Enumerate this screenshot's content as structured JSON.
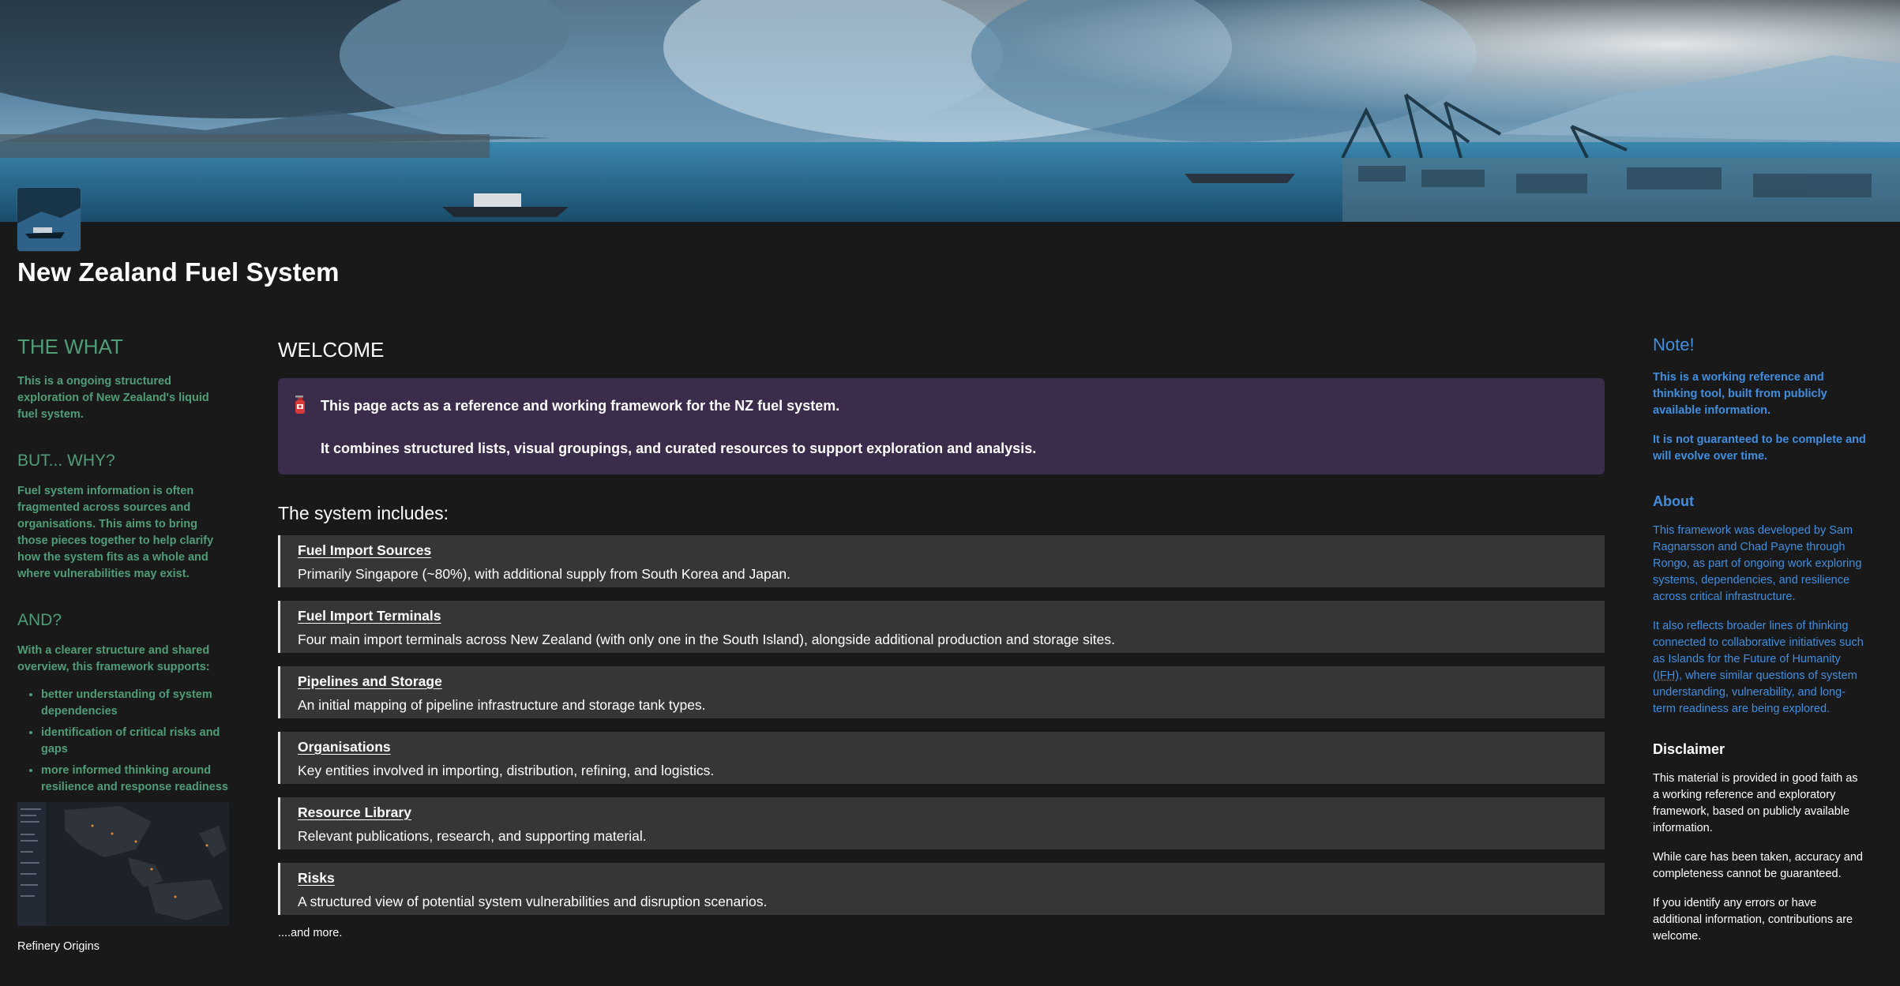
{
  "page": {
    "title": "New Zealand Fuel System"
  },
  "left": {
    "what_heading": "THE WHAT",
    "what_text": "This is a ongoing structured exploration of New Zealand's liquid fuel system.",
    "why_heading": "BUT... WHY?",
    "why_text": "Fuel system information is often fragmented across sources and organisations. This aims to bring those pieces together to help clarify how the system fits as a whole and where vulnerabilities may exist.",
    "and_heading": "AND?",
    "and_text": "With a clearer structure and shared overview, this framework supports:",
    "bullets": [
      "better understanding of system dependencies",
      "identification of critical risks and gaps",
      "more informed thinking around resilience and response readiness"
    ],
    "map_caption": "Refinery Origins"
  },
  "main": {
    "welcome": "WELCOME",
    "callout_line1": "This page acts as a reference and working framework for the NZ fuel system.",
    "callout_line2": "It combines structured lists, visual groupings, and curated resources to support exploration and analysis.",
    "includes_heading": "The system includes:",
    "items": [
      {
        "title": "Fuel Import Sources",
        "desc": "Primarily Singapore (~80%), with additional supply from South Korea and Japan."
      },
      {
        "title": "Fuel Import Terminals",
        "desc": "Four main import terminals across New Zealand (with only one in the South Island), alongside additional production and storage sites."
      },
      {
        "title": "Pipelines and Storage",
        "desc": "An initial mapping of pipeline infrastructure and storage tank types."
      },
      {
        "title": "Organisations",
        "desc": "Key entities involved in importing, distribution, refining, and logistics."
      },
      {
        "title": "Resource Library",
        "desc": "Relevant publications, research, and supporting material."
      },
      {
        "title": "Risks",
        "desc": "A structured view of potential system vulnerabilities and disruption scenarios."
      }
    ],
    "and_more": "....and more."
  },
  "right": {
    "note_heading": "Note!",
    "note_p1": "This is a working reference and thinking tool, built from publicly available information.",
    "note_p2": "It is not guaranteed to be complete and will evolve over time.",
    "about_heading": "About",
    "about_p1": "This framework was developed by Sam Ragnarsson and Chad Payne through Rongo, as part of ongoing work exploring systems, dependencies, and resilience across critical infrastructure.",
    "about_p2_before": "It also reflects broader lines of thinking connected to collaborative initiatives such as Islands for the Future of Humanity (",
    "about_p2_link": "IFH",
    "about_p2_after": "), where similar questions of system understanding, vulnerability, and long-term readiness are being explored.",
    "disclaimer_heading": "Disclaimer",
    "disclaimer_p1": "This material is provided in good faith as a working reference and exploratory framework, based on publicly available information.",
    "disclaimer_p2": "While care has been taken, accuracy and completeness cannot be guaranteed.",
    "disclaimer_p3": "If you identify any errors or have additional information, contributions are welcome."
  },
  "icons": {
    "callout": "fire-extinguisher-icon"
  },
  "colors": {
    "background": "#191919",
    "green_accent": "#4f9d78",
    "blue_accent": "#3f8ee0",
    "callout_bg": "#3c2c4b",
    "card_bg": "#363636"
  }
}
